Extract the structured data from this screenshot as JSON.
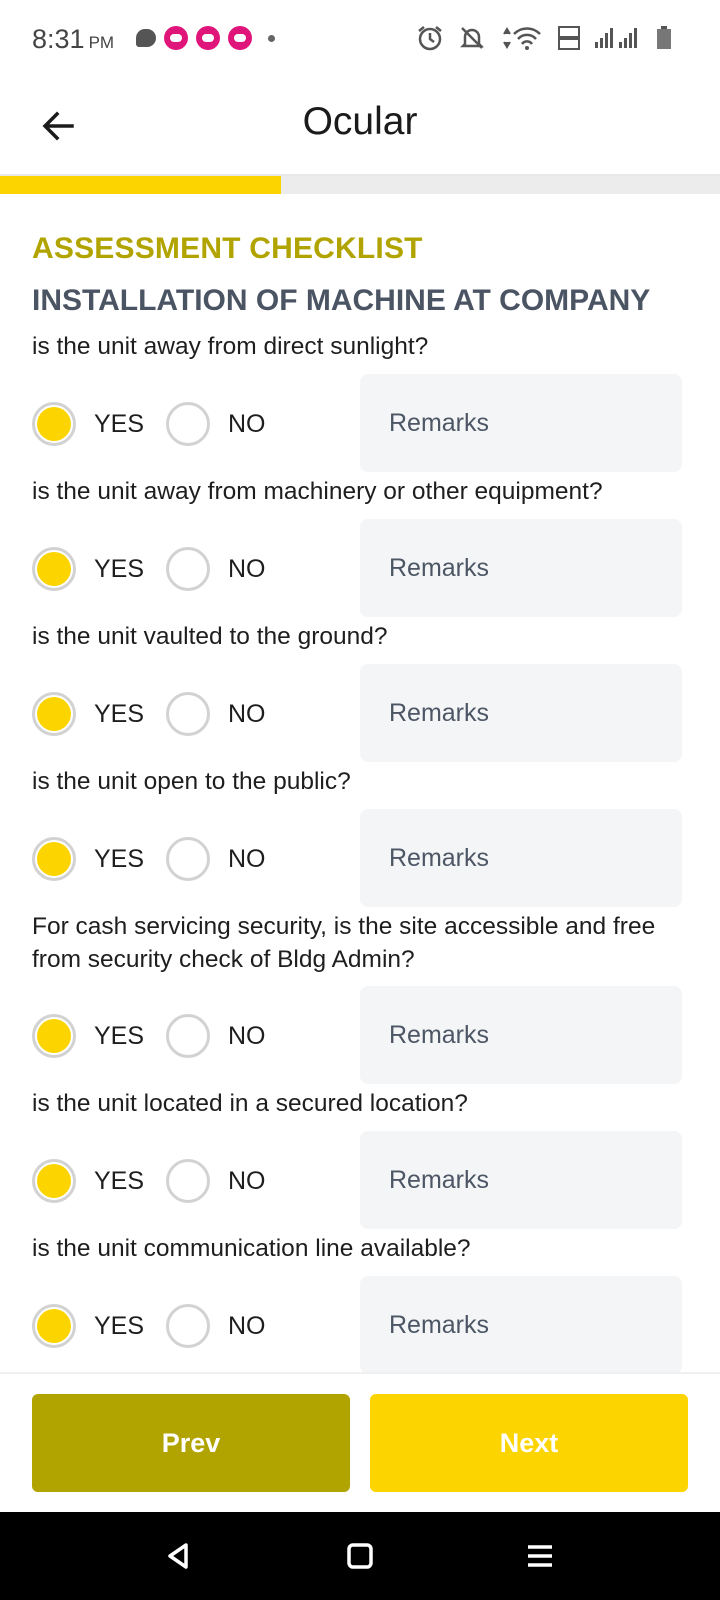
{
  "status": {
    "time": "8:31",
    "ampm": "PM"
  },
  "app": {
    "title": "Ocular",
    "progress_fraction": 0.39
  },
  "section": {
    "label": "ASSESSMENT CHECKLIST",
    "title": "INSTALLATION OF MACHINE AT COMPANY"
  },
  "options": {
    "yes": "YES",
    "no": "NO"
  },
  "remarks_placeholder": "Remarks",
  "questions": [
    {
      "text": "is the unit away from direct sunlight?",
      "answer": "YES"
    },
    {
      "text": "is the unit away from machinery or other equipment?",
      "answer": "YES"
    },
    {
      "text": "is the unit vaulted to the ground?",
      "answer": "YES"
    },
    {
      "text": "is the unit open to the public?",
      "answer": "YES"
    },
    {
      "text": "For cash servicing security, is the site accessible and free from security check of Bldg Admin?",
      "answer": "YES"
    },
    {
      "text": "is the unit located in a secured location?",
      "answer": "YES"
    },
    {
      "text": "is the unit communication line available?",
      "answer": "YES"
    }
  ],
  "buttons": {
    "prev": "Prev",
    "next": "Next"
  },
  "colors": {
    "accent": "#fcd400",
    "olive": "#b1a300",
    "section_title": "#4a5463"
  },
  "icons": {
    "status": [
      "chat-icon",
      "app-icon",
      "app-icon",
      "app-icon",
      "dot-icon",
      "alarm-icon",
      "bell-off-icon",
      "data-arrows-icon",
      "wifi-icon",
      "volte-icon",
      "signal-icon",
      "signal-icon",
      "battery-icon"
    ],
    "nav": [
      "back-triangle-icon",
      "home-square-icon",
      "menu-lines-icon"
    ]
  }
}
